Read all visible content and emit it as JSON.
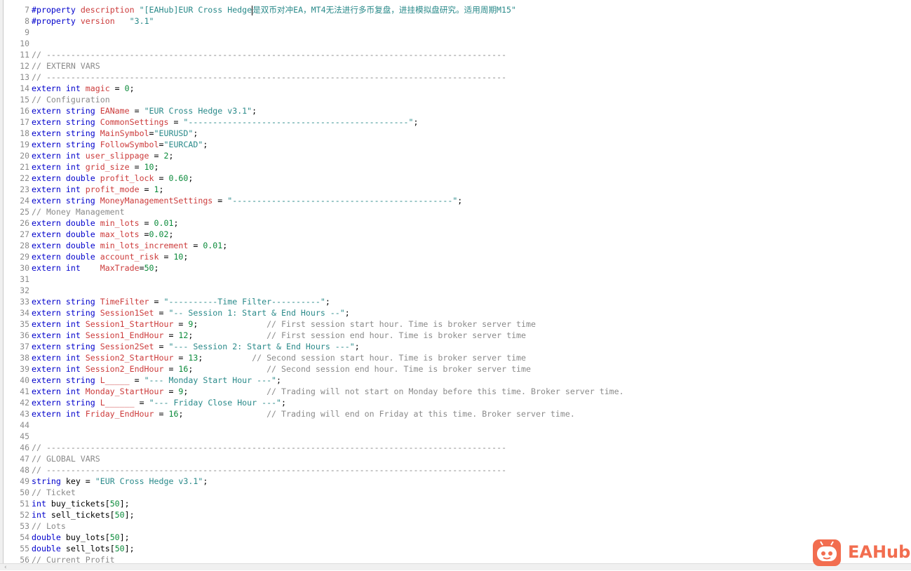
{
  "editor": {
    "lines": [
      {
        "n": "7",
        "tokens": [
          [
            "pre",
            "#property "
          ],
          [
            "v",
            "description "
          ],
          [
            "s",
            "\"[EAHub]EUR Cross Hedge"
          ],
          [
            "caret",
            ""
          ],
          [
            "s",
            "是双币对冲EA，MT4无法进行多币复盘，进挂模拟盘研究。适用周期M15\""
          ]
        ]
      },
      {
        "n": "8",
        "tokens": [
          [
            "pre",
            "#property "
          ],
          [
            "v",
            "version   "
          ],
          [
            "s",
            "\"3.1\""
          ]
        ]
      },
      {
        "n": "9",
        "tokens": []
      },
      {
        "n": "10",
        "tokens": []
      },
      {
        "n": "11",
        "tokens": [
          [
            "c",
            "// ----------------------------------------------------------------------------------------------"
          ]
        ]
      },
      {
        "n": "12",
        "tokens": [
          [
            "c",
            "// EXTERN VARS"
          ]
        ]
      },
      {
        "n": "13",
        "tokens": [
          [
            "c",
            "// ----------------------------------------------------------------------------------------------"
          ]
        ]
      },
      {
        "n": "14",
        "tokens": [
          [
            "k",
            "extern int "
          ],
          [
            "v",
            "magic"
          ],
          [
            "p",
            " = "
          ],
          [
            "n",
            "0"
          ],
          [
            "p",
            ";"
          ]
        ]
      },
      {
        "n": "15",
        "tokens": [
          [
            "c",
            "// Configuration"
          ]
        ]
      },
      {
        "n": "16",
        "tokens": [
          [
            "k",
            "extern string "
          ],
          [
            "v",
            "EAName"
          ],
          [
            "p",
            " = "
          ],
          [
            "s",
            "\"EUR Cross Hedge v3.1\""
          ],
          [
            "p",
            ";"
          ]
        ]
      },
      {
        "n": "17",
        "tokens": [
          [
            "k",
            "extern string "
          ],
          [
            "v",
            "CommonSettings"
          ],
          [
            "p",
            " = "
          ],
          [
            "s",
            "\"---------------------------------------------\""
          ],
          [
            "p",
            ";"
          ]
        ]
      },
      {
        "n": "18",
        "tokens": [
          [
            "k",
            "extern string "
          ],
          [
            "v",
            "MainSymbol"
          ],
          [
            "p",
            "="
          ],
          [
            "s",
            "\"EURUSD\""
          ],
          [
            "p",
            ";"
          ]
        ]
      },
      {
        "n": "19",
        "tokens": [
          [
            "k",
            "extern string "
          ],
          [
            "v",
            "FollowSymbol"
          ],
          [
            "p",
            "="
          ],
          [
            "s",
            "\"EURCAD\""
          ],
          [
            "p",
            ";"
          ]
        ]
      },
      {
        "n": "20",
        "tokens": [
          [
            "k",
            "extern int "
          ],
          [
            "v",
            "user_slippage"
          ],
          [
            "p",
            " = "
          ],
          [
            "n",
            "2"
          ],
          [
            "p",
            ";"
          ]
        ]
      },
      {
        "n": "21",
        "tokens": [
          [
            "k",
            "extern int "
          ],
          [
            "v",
            "grid_size"
          ],
          [
            "p",
            " = "
          ],
          [
            "n",
            "10"
          ],
          [
            "p",
            ";"
          ]
        ]
      },
      {
        "n": "22",
        "tokens": [
          [
            "k",
            "extern double "
          ],
          [
            "v",
            "profit_lock"
          ],
          [
            "p",
            " = "
          ],
          [
            "n",
            "0.60"
          ],
          [
            "p",
            ";"
          ]
        ]
      },
      {
        "n": "23",
        "tokens": [
          [
            "k",
            "extern int "
          ],
          [
            "v",
            "profit_mode"
          ],
          [
            "p",
            " = "
          ],
          [
            "n",
            "1"
          ],
          [
            "p",
            ";"
          ]
        ]
      },
      {
        "n": "24",
        "tokens": [
          [
            "k",
            "extern string "
          ],
          [
            "v",
            "MoneyManagementSettings"
          ],
          [
            "p",
            " = "
          ],
          [
            "s",
            "\"---------------------------------------------\""
          ],
          [
            "p",
            ";"
          ]
        ]
      },
      {
        "n": "25",
        "tokens": [
          [
            "c",
            "// Money Management"
          ]
        ]
      },
      {
        "n": "26",
        "tokens": [
          [
            "k",
            "extern double "
          ],
          [
            "v",
            "min_lots"
          ],
          [
            "p",
            " = "
          ],
          [
            "n",
            "0.01"
          ],
          [
            "p",
            ";"
          ]
        ]
      },
      {
        "n": "27",
        "tokens": [
          [
            "k",
            "extern double "
          ],
          [
            "v",
            "max_lots"
          ],
          [
            "p",
            " ="
          ],
          [
            "n",
            "0.02"
          ],
          [
            "p",
            ";"
          ]
        ]
      },
      {
        "n": "28",
        "tokens": [
          [
            "k",
            "extern double "
          ],
          [
            "v",
            "min_lots_increment"
          ],
          [
            "p",
            " = "
          ],
          [
            "n",
            "0.01"
          ],
          [
            "p",
            ";"
          ]
        ]
      },
      {
        "n": "29",
        "tokens": [
          [
            "k",
            "extern double "
          ],
          [
            "v",
            "account_risk"
          ],
          [
            "p",
            " = "
          ],
          [
            "n",
            "10"
          ],
          [
            "p",
            ";"
          ]
        ]
      },
      {
        "n": "30",
        "tokens": [
          [
            "k",
            "extern int    "
          ],
          [
            "v",
            "MaxTrade"
          ],
          [
            "p",
            "="
          ],
          [
            "n",
            "50"
          ],
          [
            "p",
            ";"
          ]
        ]
      },
      {
        "n": "31",
        "tokens": []
      },
      {
        "n": "32",
        "tokens": []
      },
      {
        "n": "33",
        "tokens": [
          [
            "k",
            "extern string "
          ],
          [
            "v",
            "TimeFilter"
          ],
          [
            "p",
            " = "
          ],
          [
            "s",
            "\"----------Time Filter----------\""
          ],
          [
            "p",
            ";"
          ]
        ]
      },
      {
        "n": "34",
        "tokens": [
          [
            "k",
            "extern string "
          ],
          [
            "v",
            "Session1Set"
          ],
          [
            "p",
            " = "
          ],
          [
            "s",
            "\"-- Session 1: Start & End Hours --\""
          ],
          [
            "p",
            ";"
          ]
        ]
      },
      {
        "n": "35",
        "tokens": [
          [
            "k",
            "extern int "
          ],
          [
            "v",
            "Session1_StartHour"
          ],
          [
            "p",
            " = "
          ],
          [
            "n",
            "9"
          ],
          [
            "p",
            ";              "
          ],
          [
            "c",
            "// First session start hour. Time is broker server time"
          ]
        ]
      },
      {
        "n": "36",
        "tokens": [
          [
            "k",
            "extern int "
          ],
          [
            "v",
            "Session1_EndHour"
          ],
          [
            "p",
            " = "
          ],
          [
            "n",
            "12"
          ],
          [
            "p",
            ";               "
          ],
          [
            "c",
            "// First session end hour. Time is broker server time"
          ]
        ]
      },
      {
        "n": "37",
        "tokens": [
          [
            "k",
            "extern string "
          ],
          [
            "v",
            "Session2Set"
          ],
          [
            "p",
            " = "
          ],
          [
            "s",
            "\"--- Session 2: Start & End Hours ---\""
          ],
          [
            "p",
            ";"
          ]
        ]
      },
      {
        "n": "38",
        "tokens": [
          [
            "k",
            "extern int "
          ],
          [
            "v",
            "Session2_StartHour"
          ],
          [
            "p",
            " = "
          ],
          [
            "n",
            "13"
          ],
          [
            "p",
            ";          "
          ],
          [
            "c",
            "// Second session start hour. Time is broker server time"
          ]
        ]
      },
      {
        "n": "39",
        "tokens": [
          [
            "k",
            "extern int "
          ],
          [
            "v",
            "Session2_EndHour"
          ],
          [
            "p",
            " = "
          ],
          [
            "n",
            "16"
          ],
          [
            "p",
            ";               "
          ],
          [
            "c",
            "// Second session end hour. Time is broker server time"
          ]
        ]
      },
      {
        "n": "40",
        "tokens": [
          [
            "k",
            "extern string "
          ],
          [
            "v",
            "L_____"
          ],
          [
            "p",
            " = "
          ],
          [
            "s",
            "\"--- Monday Start Hour ---\""
          ],
          [
            "p",
            ";"
          ]
        ]
      },
      {
        "n": "41",
        "tokens": [
          [
            "k",
            "extern int "
          ],
          [
            "v",
            "Monday_StartHour"
          ],
          [
            "p",
            " = "
          ],
          [
            "n",
            "9"
          ],
          [
            "p",
            ";                "
          ],
          [
            "c",
            "// Trading will not start on Monday before this time. Broker server time."
          ]
        ]
      },
      {
        "n": "42",
        "tokens": [
          [
            "k",
            "extern string "
          ],
          [
            "v",
            "L______"
          ],
          [
            "p",
            " = "
          ],
          [
            "s",
            "\"--- Friday Close Hour ---\""
          ],
          [
            "p",
            ";"
          ]
        ]
      },
      {
        "n": "43",
        "tokens": [
          [
            "k",
            "extern int "
          ],
          [
            "v",
            "Friday_EndHour"
          ],
          [
            "p",
            " = "
          ],
          [
            "n",
            "16"
          ],
          [
            "p",
            ";                 "
          ],
          [
            "c",
            "// Trading will end on Friday at this time. Broker server time."
          ]
        ]
      },
      {
        "n": "44",
        "tokens": []
      },
      {
        "n": "45",
        "tokens": []
      },
      {
        "n": "46",
        "tokens": [
          [
            "c",
            "// ----------------------------------------------------------------------------------------------"
          ]
        ]
      },
      {
        "n": "47",
        "tokens": [
          [
            "c",
            "// GLOBAL VARS"
          ]
        ]
      },
      {
        "n": "48",
        "tokens": [
          [
            "c",
            "// ----------------------------------------------------------------------------------------------"
          ]
        ]
      },
      {
        "n": "49",
        "tokens": [
          [
            "k",
            "string "
          ],
          [
            "p",
            "key = "
          ],
          [
            "s",
            "\"EUR Cross Hedge v3.1\""
          ],
          [
            "p",
            ";"
          ]
        ]
      },
      {
        "n": "50",
        "tokens": [
          [
            "c",
            "// Ticket"
          ]
        ]
      },
      {
        "n": "51",
        "tokens": [
          [
            "k",
            "int "
          ],
          [
            "p",
            "buy_tickets["
          ],
          [
            "n",
            "50"
          ],
          [
            "p",
            "];"
          ]
        ]
      },
      {
        "n": "52",
        "tokens": [
          [
            "k",
            "int "
          ],
          [
            "p",
            "sell_tickets["
          ],
          [
            "n",
            "50"
          ],
          [
            "p",
            "];"
          ]
        ]
      },
      {
        "n": "53",
        "tokens": [
          [
            "c",
            "// Lots"
          ]
        ]
      },
      {
        "n": "54",
        "tokens": [
          [
            "k",
            "double "
          ],
          [
            "p",
            "buy_lots["
          ],
          [
            "n",
            "50"
          ],
          [
            "p",
            "];"
          ]
        ]
      },
      {
        "n": "55",
        "tokens": [
          [
            "k",
            "double "
          ],
          [
            "p",
            "sell_lots["
          ],
          [
            "n",
            "50"
          ],
          [
            "p",
            "];"
          ]
        ]
      },
      {
        "n": "56",
        "tokens": [
          [
            "c",
            "// Current Profit"
          ]
        ]
      }
    ]
  },
  "scrollbar": {
    "left_arrow": "‹"
  },
  "watermark": {
    "text": "EAHub",
    "icon": "robot-icon",
    "color": "#f26d4f"
  }
}
